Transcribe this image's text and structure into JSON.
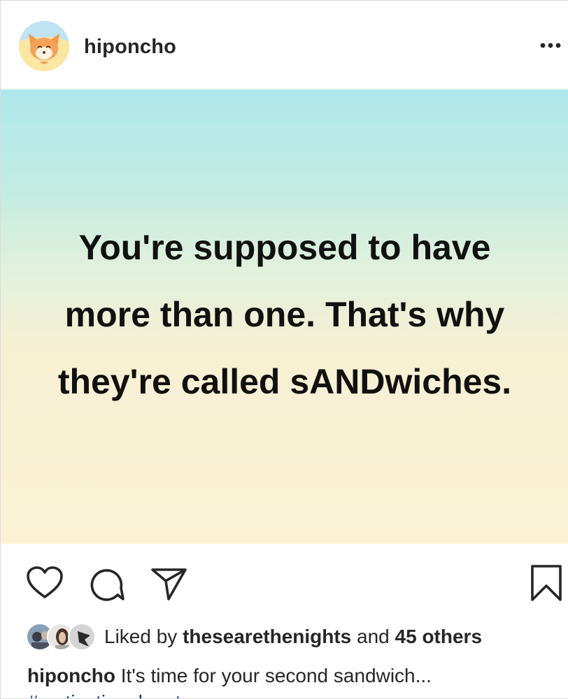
{
  "post": {
    "username": "hiponcho",
    "quote_lines": [
      "You're supposed to have",
      "more than one. That's why",
      "they're called sANDwiches."
    ],
    "likes": {
      "prefix": "Liked by",
      "user": "thesearethenights",
      "middle": "and",
      "others": "45 others"
    },
    "caption": {
      "username": "hiponcho",
      "text": "It's time for your second sandwich...",
      "hashtag": "#motivationalquotes"
    }
  },
  "icons": {
    "more": "more-options-icon",
    "like": "heart-icon",
    "comment": "comment-icon",
    "share": "paper-plane-icon",
    "save": "bookmark-icon"
  },
  "colors": {
    "text": "#262626",
    "hashtag": "#003569",
    "gradient_top": "#aee8ec",
    "gradient_bottom": "#fbf2d6"
  }
}
